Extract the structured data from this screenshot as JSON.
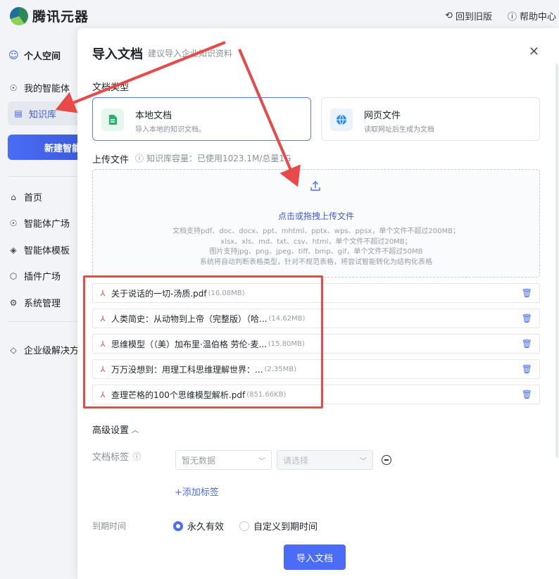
{
  "app": {
    "name": "腾讯元器"
  },
  "topbar": {
    "back_label": "回到旧版",
    "help_label": "帮助中心"
  },
  "sidebar": {
    "personal_space": "个人空间",
    "items": [
      {
        "label": "我的智能体",
        "icon": "robot-icon"
      },
      {
        "label": "知识库",
        "icon": "document-icon",
        "active": true
      }
    ],
    "new_button": "新建智能",
    "nav": [
      {
        "label": "首页",
        "icon": "home-icon"
      },
      {
        "label": "智能体广场",
        "icon": "robot-icon"
      },
      {
        "label": "智能体模板",
        "icon": "template-icon"
      },
      {
        "label": "插件广场",
        "icon": "plugin-icon"
      },
      {
        "label": "系统管理",
        "icon": "gear-icon"
      }
    ],
    "enterprise": "企业级解决方"
  },
  "modal": {
    "title": "导入文档",
    "subtitle": "建议导入企业知识资料",
    "doc_type_label": "文档类型",
    "doc_types": [
      {
        "title": "本地文档",
        "desc": "导入本地的知识文档。",
        "selected": true
      },
      {
        "title": "网页文件",
        "desc": "读取网址后生成为文档",
        "selected": false
      }
    ],
    "upload_label": "上传文件",
    "capacity_hint": "知识库容量：已使用1023.1M/总量1G",
    "dropzone": {
      "title": "点击或拖拽上传文件",
      "lines": [
        "文档支持pdf、doc、docx、ppt、mhtml、pptx、wps、ppsx，单个文件不超过200MB；",
        "xlsx、xls、md、txt、csv、html，单个文件不超过20MB；",
        "图片支持jpg、png、jpeg、tiff、bmp、gif，单个文件不超过50MB",
        "系统将自动判断表格类型，针对不规范表格，将尝试智能转化为结构化表格"
      ]
    },
    "files": [
      {
        "name": "关于说话的一切-汤质.pdf",
        "size": "(16.08MB)"
      },
      {
        "name": "人类简史：从动物到上帝（完整版）（哈...",
        "size": "(14.62MB)"
      },
      {
        "name": "思维模型（（美）加布里·温伯格 劳伦·麦...",
        "size": "(15.80MB)"
      },
      {
        "name": "万万没想到：用理工科思维理解世界：...",
        "size": "(2.35MB)"
      },
      {
        "name": "查理芒格的100个思维模型解析.pdf",
        "size": "(851.66KB)"
      }
    ],
    "advanced_label": "高级设置",
    "tag_label": "文档标签",
    "tag_select_placeholder": "暂无数据",
    "tag_value_placeholder": "请选择",
    "add_tag": "+添加标签",
    "expire_label": "到期时间",
    "expire_options": [
      {
        "label": "永久有效",
        "selected": true
      },
      {
        "label": "自定义到期时间",
        "selected": false
      }
    ],
    "submit_label": "导入文档"
  },
  "colors": {
    "accent": "#4a6cf7",
    "annotation": "#e84a4a",
    "pdf": "#e5483a"
  }
}
